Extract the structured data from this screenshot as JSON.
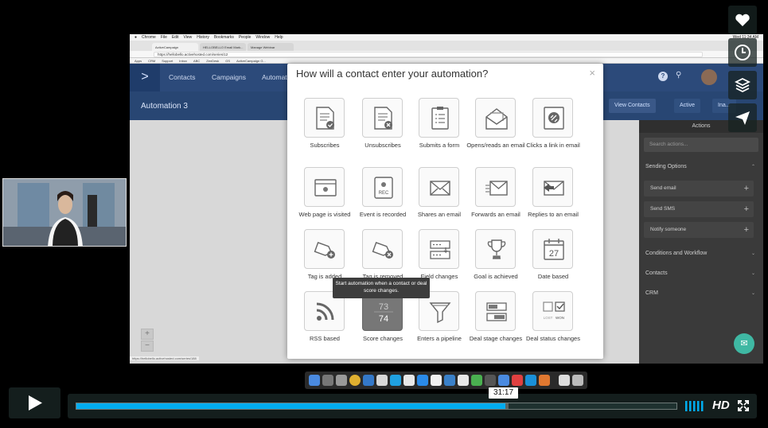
{
  "screen": {
    "menubar": {
      "items": [
        "Chrome",
        "File",
        "Edit",
        "View",
        "History",
        "Bookmarks",
        "People",
        "Window",
        "Help"
      ],
      "clock": "Wed 11:34 AM"
    },
    "tabs": [
      "ActiveCampaign",
      "HELLOBELLO Email Mark...",
      "Manage Webinar"
    ],
    "url": "https://hellobello.activehosted.com/series/12",
    "bookmarks": [
      "Apps",
      "CRM",
      "Support",
      "Inbox",
      "ABC",
      "ZenDesk",
      "GS",
      "ActiveCampaign G..."
    ],
    "status_url": "https://hellobello.activehosted.com/series/188"
  },
  "app": {
    "logo": ">",
    "nav": {
      "contacts": "Contacts",
      "campaigns": "Campaigns",
      "automations": "Automat"
    },
    "automation_title": "Automation 3",
    "view_contacts": "View Contacts",
    "active": "Active",
    "inactive": "Ina..."
  },
  "actions_panel": {
    "title": "Actions",
    "search_placeholder": "Search actions...",
    "sending_options": "Sending Options",
    "send_email": "Send email",
    "send_sms": "Send SMS",
    "notify_someone": "Notify someone",
    "conditions_workflow": "Conditions and Workflow",
    "contacts": "Contacts",
    "crm": "CRM"
  },
  "modal": {
    "title": "How will a contact enter your automation?",
    "close": "×",
    "options": [
      "Subscribes",
      "Unsubscribes",
      "Submits a form",
      "Opens/reads an email",
      "Clicks a link in email",
      "Web page is visited",
      "Event is recorded",
      "Shares an email",
      "Forwards an email",
      "Replies to an email",
      "Tag is added",
      "Tag is removed",
      "Field changes",
      "Goal is achieved",
      "Date based",
      "RSS based",
      "Score changes",
      "Enters a pipeline",
      "Deal stage changes",
      "Deal status changes"
    ],
    "tile_text": {
      "rec": "REC",
      "date": "27",
      "score_top": "73",
      "score_bottom": "74",
      "lost": "LOST",
      "won": "WON"
    },
    "tooltip": "Start automation when a contact or deal score changes."
  },
  "player": {
    "time": "31:17",
    "progress": 0.715,
    "loaded": 0.72,
    "hd": "HD"
  },
  "colors": {
    "accent": "#00adef",
    "nav": "#2c4a7a",
    "panel": "#3a3a3a"
  }
}
